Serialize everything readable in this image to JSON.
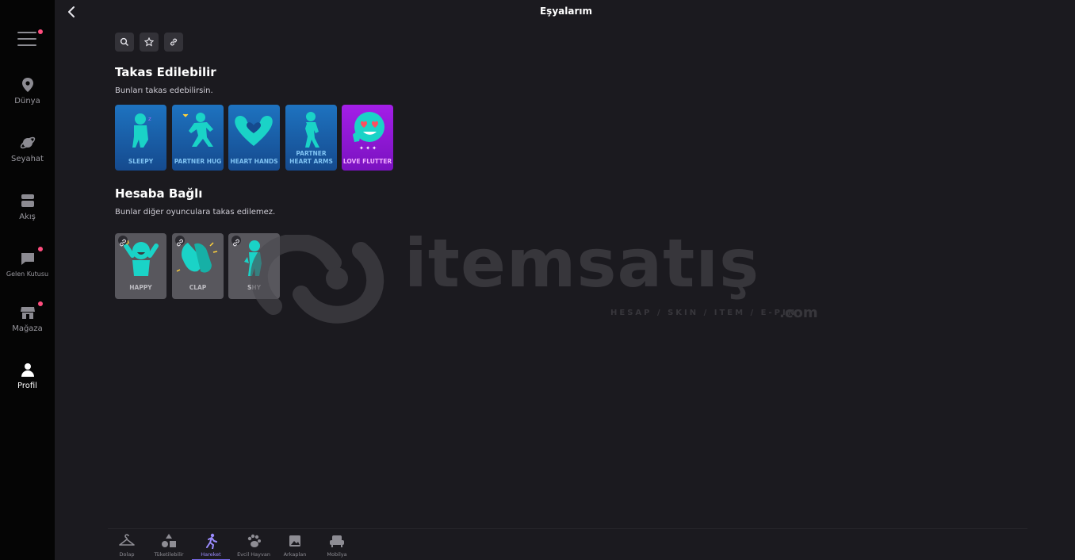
{
  "header": {
    "title": "Eşyalarım"
  },
  "sidebar": {
    "items": [
      {
        "label": "Dünya",
        "icon": "map-pin-icon"
      },
      {
        "label": "Seyahat",
        "icon": "planet-icon"
      },
      {
        "label": "Akış",
        "icon": "feed-icon"
      },
      {
        "label": "Gelen Kutusu",
        "icon": "chat-bubble-icon"
      },
      {
        "label": "Mağaza",
        "icon": "store-icon"
      },
      {
        "label": "Profil",
        "icon": "person-icon"
      }
    ]
  },
  "tools": [
    "search-icon",
    "star-icon",
    "link-icon"
  ],
  "tradeable": {
    "title": "Takas Edilebilir",
    "subtitle": "Bunları takas edebilirsin.",
    "cards": [
      {
        "label": "SLEEPY",
        "color": "#1e73c0"
      },
      {
        "label": "PARTNER HUG",
        "color": "#1e73c0"
      },
      {
        "label": "HEART HANDS",
        "color": "#1e73c0"
      },
      {
        "label": "PARTNER HEART ARMS",
        "color": "#1e73c0"
      },
      {
        "label": "LOVE FLUTTER",
        "color": "#a41ee8"
      }
    ]
  },
  "bound": {
    "title": "Hesaba Bağlı",
    "subtitle": "Bunlar diğer oyunculara takas edilemez.",
    "cards": [
      {
        "label": "HAPPY"
      },
      {
        "label": "CLAP"
      },
      {
        "label": "SHY"
      }
    ]
  },
  "watermark": {
    "text": "itemsatış",
    "sub": "HESAP / SKIN / ITEM / E-PIN",
    "com": ".com"
  },
  "bottom_tabs": [
    {
      "label": "Dolap",
      "icon": "hanger-icon"
    },
    {
      "label": "Tüketilebilir",
      "icon": "shapes-icon"
    },
    {
      "label": "Hareket",
      "icon": "running-figure-icon",
      "active": true
    },
    {
      "label": "Evcil Hayvan",
      "icon": "paw-icon"
    },
    {
      "label": "Arkaplan",
      "icon": "image-icon"
    },
    {
      "label": "Mobilya",
      "icon": "sofa-icon"
    }
  ],
  "colors": {
    "accent": "#7a6cf0",
    "notification": "#ff4d7e",
    "figure": "#1ad3c7"
  }
}
